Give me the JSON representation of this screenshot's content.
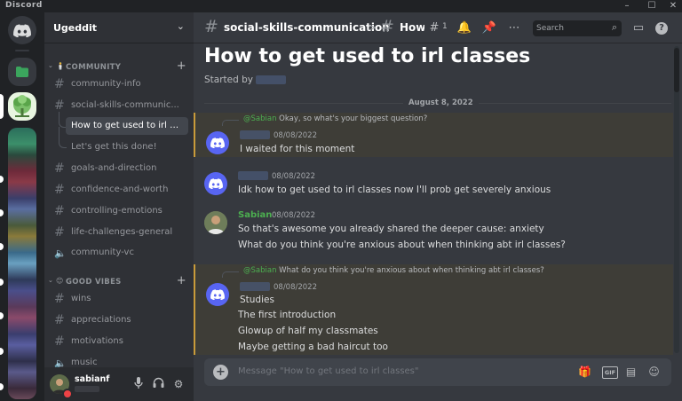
{
  "window": {
    "app_name": "Discord",
    "min": "–",
    "max": "☐",
    "close": "✕"
  },
  "server": {
    "name": "Ugeddit",
    "categories": [
      {
        "label": "COMMUNITY",
        "emoji": "🕯️"
      },
      {
        "label": "GOOD VIBES",
        "emoji": "😊"
      }
    ],
    "channels": {
      "community_info": "community-info",
      "social_skills": "social-skills-communic...",
      "thread_active": "How to get used to irl cla...",
      "thread_done": "Let's get this done!",
      "goals": "goals-and-direction",
      "confidence": "confidence-and-worth",
      "emotions": "controlling-emotions",
      "life": "life-challenges-general",
      "community_vc": "community-vc",
      "wins": "wins",
      "appreciations": "appreciations",
      "motivations": "motivations",
      "music": "music"
    }
  },
  "user": {
    "name": "sabianf"
  },
  "topbar": {
    "channel": "social-skills-communication",
    "separator": ">",
    "thread": "How",
    "thread_count": "1",
    "search_placeholder": "Search"
  },
  "thread": {
    "title": "How to get used to irl classes",
    "started_by": "Started by"
  },
  "date_divider": "August 8, 2022",
  "messages": [
    {
      "reply_name": "@Sabian",
      "reply_text": "Okay, so what's your biggest question?",
      "time": "08/08/2022",
      "lines": [
        "I waited for this moment"
      ]
    },
    {
      "time": "08/08/2022",
      "lines": [
        "Idk how to get used to irl classes now I'll prob get severely anxious"
      ]
    },
    {
      "name": "Sabian",
      "name_color": "#4caf50",
      "time": "08/08/2022",
      "lines": [
        "So that's awesome you already shared the deeper cause: anxiety",
        "What do you think you're anxious about when thinking abt irl classes?"
      ]
    },
    {
      "reply_name": "@Sabian",
      "reply_text": "What do you think you're anxious about when thinking abt irl classes?",
      "time": "08/08/2022",
      "lines": [
        "Studies",
        "The first introduction",
        "Glowup of half my classmates",
        "Maybe getting a bad haircut too"
      ]
    }
  ],
  "composer": {
    "placeholder": "Message \"How to get used to irl classes\"",
    "gif": "GIF"
  },
  "colors": {
    "accent": "#5865f2",
    "highlight_border": "#c99b3a",
    "green_name": "#4caf50"
  },
  "icons": [
    "discord-logo-icon",
    "folder-icon",
    "chevron-down-icon",
    "hash-icon",
    "thread-icon",
    "bell-icon",
    "pin-icon",
    "more-icon",
    "search-icon",
    "inbox-icon",
    "help-icon",
    "mic-icon",
    "headphones-icon",
    "gear-icon",
    "gift-icon",
    "sticker-icon",
    "emoji-icon"
  ]
}
